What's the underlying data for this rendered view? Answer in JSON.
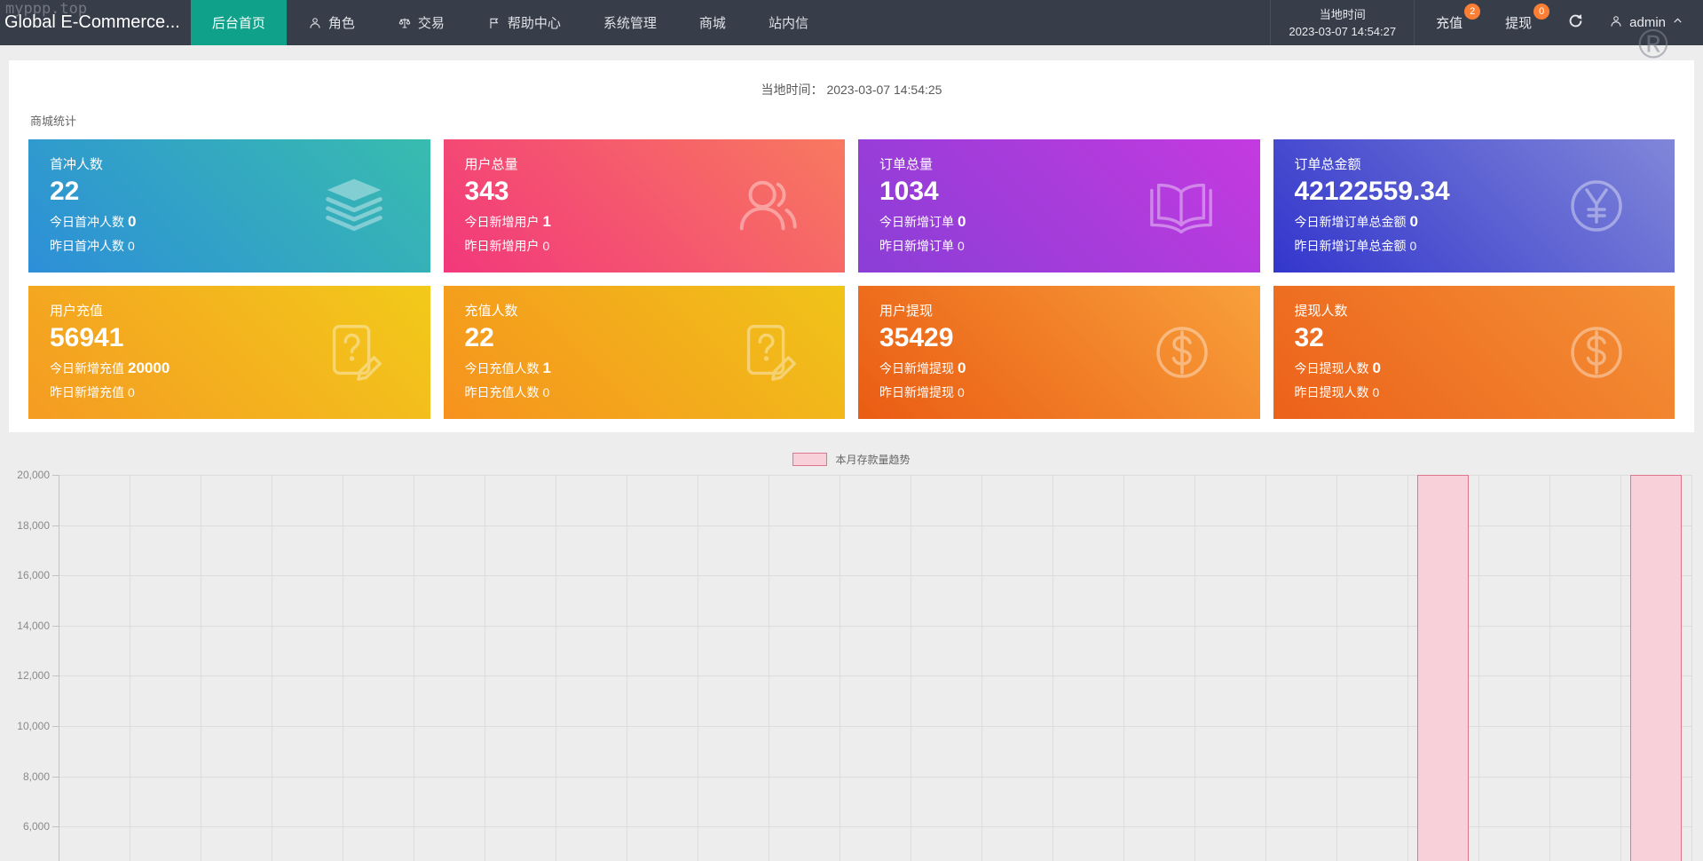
{
  "theme": {
    "navbar_bg": "#373d49",
    "active_tab_green": "#0fa18a",
    "badge_orange": "#fb7e35",
    "page_bg": "#ededed",
    "panel_bg": "#ffffff"
  },
  "watermarks": {
    "top_left": "myppp.top",
    "registered": "®"
  },
  "navbar": {
    "brand": "Global E-Commerce...",
    "menu": [
      {
        "name": "home",
        "label": "后台首页",
        "active": true
      },
      {
        "name": "roles",
        "label": "角色",
        "icon": "person-icon"
      },
      {
        "name": "trade",
        "label": "交易",
        "icon": "scales-icon"
      },
      {
        "name": "help-center",
        "label": "帮助中心",
        "icon": "flag-icon"
      },
      {
        "name": "system",
        "label": "系统管理"
      },
      {
        "name": "mall",
        "label": "商城"
      },
      {
        "name": "messages",
        "label": "站内信"
      }
    ],
    "local_time": {
      "label": "当地时间",
      "value": "2023-03-07 14:54:27"
    },
    "actions": {
      "recharge": {
        "label": "充值",
        "badge": "2"
      },
      "withdraw": {
        "label": "提现",
        "badge": "0"
      }
    },
    "user": {
      "name": "admin"
    }
  },
  "content": {
    "local_time_line": {
      "label": "当地时间：",
      "value": "2023-03-07 14:54:25"
    },
    "section_title": "商城统计",
    "cards": [
      {
        "name": "first-charge-users",
        "title": "首冲人数",
        "value": "22",
        "today_label": "今日首冲人数",
        "today_value": "0",
        "yesterday_label": "昨日首冲人数",
        "yesterday_value": "0",
        "icon": "layers-icon",
        "gradient": [
          "#2d8fd8",
          "#38bcae"
        ]
      },
      {
        "name": "total-users",
        "title": "用户总量",
        "value": "343",
        "today_label": "今日新增用户",
        "today_value": "1",
        "yesterday_label": "昨日新增用户",
        "yesterday_value": "0",
        "icon": "users-icon",
        "gradient": [
          "#f2387c",
          "#f8795f"
        ]
      },
      {
        "name": "total-orders",
        "title": "订单总量",
        "value": "1034",
        "today_label": "今日新增订单",
        "today_value": "0",
        "yesterday_label": "昨日新增订单",
        "yesterday_value": "0",
        "icon": "book-icon",
        "gradient": [
          "#8a3ed6",
          "#c43ae0"
        ]
      },
      {
        "name": "total-order-amount",
        "title": "订单总金额",
        "value": "42122559.34",
        "today_label": "今日新增订单总金额",
        "today_value": "0",
        "yesterday_label": "昨日新增订单总金额",
        "yesterday_value": "0",
        "icon": "yen-circle-icon",
        "gradient": [
          "#3336cc",
          "#8087d8"
        ]
      },
      {
        "name": "user-recharge",
        "title": "用户充值",
        "value": "56941",
        "today_label": "今日新增充值",
        "today_value": "20000",
        "yesterday_label": "昨日新增充值",
        "yesterday_value": "0",
        "icon": "doc-edit-icon",
        "gradient": [
          "#f59b22",
          "#f2ca1a"
        ]
      },
      {
        "name": "recharge-users",
        "title": "充值人数",
        "value": "22",
        "today_label": "今日充值人数",
        "today_value": "1",
        "yesterday_label": "昨日充值人数",
        "yesterday_value": "0",
        "icon": "doc-edit-icon",
        "gradient": [
          "#f6921e",
          "#f0c419"
        ]
      },
      {
        "name": "user-withdraw",
        "title": "用户提现",
        "value": "35429",
        "today_label": "今日新增提现",
        "today_value": "0",
        "yesterday_label": "昨日新增提现",
        "yesterday_value": "0",
        "icon": "dollar-circle-icon",
        "gradient": [
          "#ea5c13",
          "#f8a03b"
        ]
      },
      {
        "name": "withdraw-users",
        "title": "提现人数",
        "value": "32",
        "today_label": "今日提现人数",
        "today_value": "0",
        "yesterday_label": "昨日提现人数",
        "yesterday_value": "0",
        "icon": "dollar-circle-icon",
        "gradient": [
          "#ec621a",
          "#f49136"
        ]
      }
    ]
  },
  "chart_data": {
    "type": "bar",
    "legend": "本月存款量趋势",
    "legend_position": "top-center",
    "grid": true,
    "y_axis": {
      "visible_max": 20000,
      "visible_min": 6000,
      "tick_step": 2000
    },
    "y_ticks": [
      20000,
      18000,
      16000,
      14000,
      12000,
      10000,
      8000,
      6000
    ],
    "y_tick_labels": [
      "20,000",
      "18,000",
      "16,000",
      "14,000",
      "12,000",
      "10,000",
      "8,000",
      "6,000"
    ],
    "x_axis": {
      "labels_visible": false,
      "visible_bands": 23
    },
    "series": [
      {
        "name": "本月存款量趋势",
        "values": [
          0,
          0,
          0,
          0,
          0,
          0,
          0,
          0,
          0,
          0,
          0,
          0,
          0,
          0,
          0,
          0,
          0,
          0,
          0,
          20000,
          0,
          0,
          20000
        ]
      }
    ],
    "bars": [
      {
        "position": 20,
        "value": 20000
      },
      {
        "position": 23,
        "value": 20000
      }
    ],
    "colors": {
      "bar_fill": "#f7d0da",
      "bar_border": "#e0758e"
    },
    "note": "Chart clipped at bottom of viewport; bar tops align with the 20,000 gridline."
  }
}
